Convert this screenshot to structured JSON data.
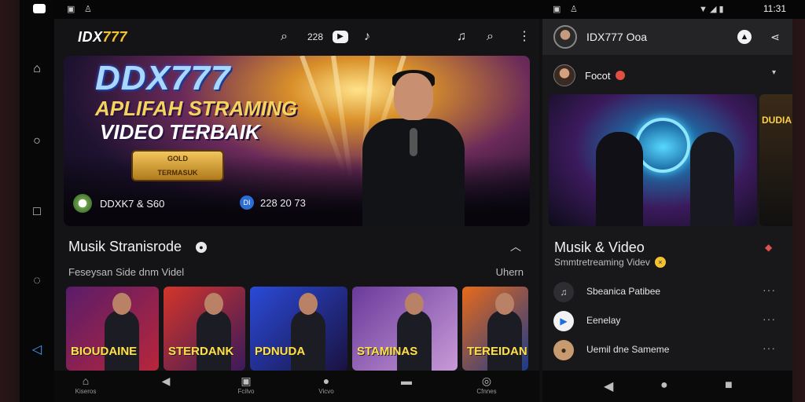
{
  "status_bar": {
    "clock": "11:31"
  },
  "main": {
    "brand": {
      "prefix": "IDX",
      "suffix": "777"
    },
    "header_counter": "228",
    "hero": {
      "title": "DDX777",
      "subtitle_line1": "APLIFAH STRAMING",
      "subtitle_line2": "VIDEO TERBAIK",
      "ribbon_line1": "GOLD",
      "ribbon_line2": "TERMASUK",
      "channel_name": "DDXK7 & S60",
      "stats": "228 20 73",
      "stats_icon_text": "DI"
    },
    "section": {
      "title": "Musik Stranisrode",
      "subtitle": "Feseysan Side dnm Videl",
      "link": "Uhern"
    },
    "thumbnails": [
      {
        "text": "BIOUDAINE",
        "colors": [
          "#5a1c6a",
          "#b8263a"
        ]
      },
      {
        "text": "STERDANK",
        "colors": [
          "#d4352a",
          "#3a1a5a"
        ]
      },
      {
        "text": "PDNUDA",
        "colors": [
          "#2a4ad8",
          "#1a1240"
        ]
      },
      {
        "text": "STAMINAS",
        "colors": [
          "#6a3a9a",
          "#c89ad8"
        ]
      },
      {
        "text": "TEREIDAN",
        "colors": [
          "#e86a1a",
          "#1a3a8a"
        ]
      }
    ],
    "bottom_nav": [
      {
        "icon": "home-icon",
        "glyph": "⌂",
        "label": "Kiseros"
      },
      {
        "icon": "back-icon",
        "glyph": "◀",
        "label": ""
      },
      {
        "icon": "library-icon",
        "glyph": "▣",
        "label": "Fcilvo"
      },
      {
        "icon": "chat-icon",
        "glyph": "●",
        "label": "Vicvo"
      },
      {
        "icon": "tv-icon",
        "glyph": "▬",
        "label": ""
      },
      {
        "icon": "profile-icon",
        "glyph": "◎",
        "label": "Cfnnes"
      }
    ]
  },
  "right": {
    "title": "IDX777 Ooa",
    "channel_row": {
      "name": "Focot"
    },
    "video2_text": "DUDIA",
    "section": {
      "title": "Musik & Video",
      "subtitle": "Smmtretreaming Videv"
    },
    "list": [
      {
        "label": "Sbeanica Patibee",
        "icon": "music-icon",
        "icon_bg": "#2e2e32",
        "icon_color": "#cfcfcf",
        "glyph": "♫"
      },
      {
        "label": "Eenelay",
        "icon": "play-icon",
        "icon_bg": "#f2f2f2",
        "icon_color": "#1b6fe0",
        "glyph": "▶"
      },
      {
        "label": "Uemil dne Sameme",
        "icon": "avatar-icon",
        "icon_bg": "#c89a70",
        "icon_color": "#3a2a1a",
        "glyph": "●"
      }
    ]
  },
  "colors": {
    "accent": "#f2c230",
    "background": "#141416",
    "panel": "#18181a"
  }
}
